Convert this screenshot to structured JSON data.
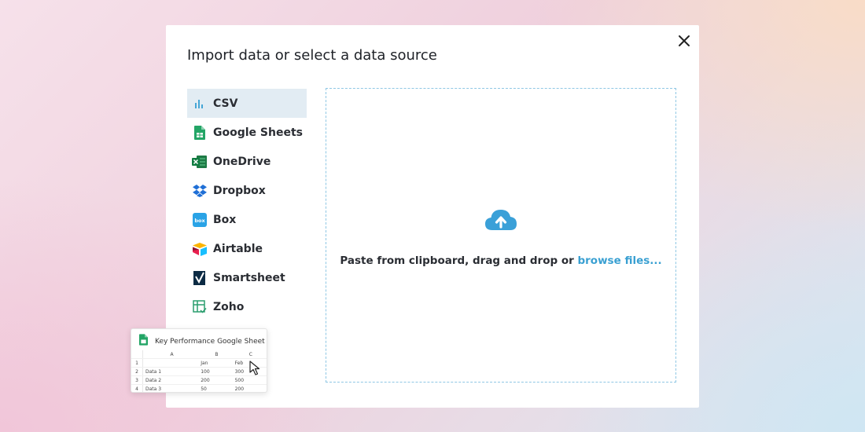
{
  "modal": {
    "title": "Import data or select a data source"
  },
  "sources": [
    {
      "label": "CSV",
      "icon": "csv-bar-chart-icon",
      "active": true
    },
    {
      "label": "Google Sheets",
      "icon": "google-sheets-icon"
    },
    {
      "label": "OneDrive",
      "icon": "excel-onedrive-icon"
    },
    {
      "label": "Dropbox",
      "icon": "dropbox-icon"
    },
    {
      "label": "Box",
      "icon": "box-icon"
    },
    {
      "label": "Airtable",
      "icon": "airtable-icon"
    },
    {
      "label": "Smartsheet",
      "icon": "smartsheet-icon"
    },
    {
      "label": "Zoho",
      "icon": "zoho-icon"
    }
  ],
  "dropzone": {
    "text": "Paste from clipboard, drag and drop or ",
    "link": "browse files..."
  },
  "sheet_preview": {
    "title": "Key Performance Google Sheet",
    "columns": [
      "A",
      "B",
      "C"
    ],
    "rows": [
      [
        "1",
        "",
        "Jan",
        "Feb"
      ],
      [
        "2",
        "Data 1",
        "100",
        "300"
      ],
      [
        "3",
        "Data 2",
        "200",
        "500"
      ],
      [
        "4",
        "Data 3",
        "50",
        "200"
      ]
    ]
  },
  "colors": {
    "accent": "#3aa0d2",
    "active_bg": "#e2ecf3",
    "dropzone_border": "#8fc7e4"
  }
}
